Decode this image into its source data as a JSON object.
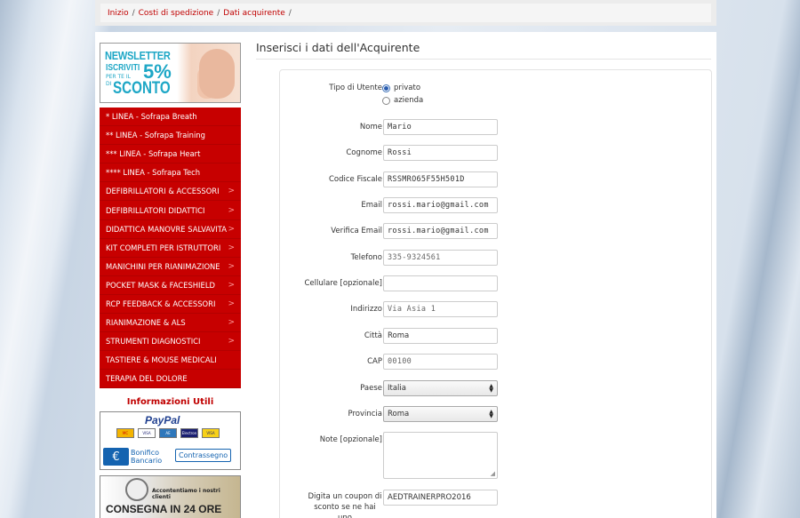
{
  "breadcrumb": {
    "items": [
      "Inizio",
      "Costi di spedizione",
      "Dati acquirente"
    ],
    "separator": "/"
  },
  "banner": {
    "line1": "NEWSLETTER",
    "line2": "ISCRIVITI",
    "line3": "PER TE IL",
    "percent": "5%",
    "line5": "DI",
    "line6": "SCONTO"
  },
  "sidebar": {
    "items": [
      {
        "label": "* LINEA - Sofrapa Breath",
        "submenu": false
      },
      {
        "label": "** LINEA - Sofrapa Training",
        "submenu": false
      },
      {
        "label": "*** LINEA - Sofrapa Heart",
        "submenu": false
      },
      {
        "label": "**** LINEA - Sofrapa Tech",
        "submenu": false
      },
      {
        "label": "DEFIBRILLATORI & ACCESSORI",
        "submenu": true
      },
      {
        "label": "DEFIBRILLATORI DIDATTICI",
        "submenu": true
      },
      {
        "label": "DIDATTICA MANOVRE SALVAVITA",
        "submenu": true
      },
      {
        "label": "KIT COMPLETI PER ISTRUTTORI",
        "submenu": true
      },
      {
        "label": "MANICHINI PER RIANIMAZIONE",
        "submenu": true
      },
      {
        "label": "POCKET MASK & FACESHIELD",
        "submenu": true
      },
      {
        "label": "RCP FEEDBACK & ACCESSORI",
        "submenu": true
      },
      {
        "label": "RIANIMAZIONE & ALS",
        "submenu": true
      },
      {
        "label": "STRUMENTI DIAGNOSTICI",
        "submenu": true
      },
      {
        "label": "TASTIERE & MOUSE MEDICALI",
        "submenu": false
      },
      {
        "label": "TERAPIA DEL DOLORE",
        "submenu": false
      }
    ],
    "chevron": ">",
    "info_title": "Informazioni Utili",
    "payment": {
      "paypal": "PayPal",
      "cards": [
        "MC",
        "VISA",
        "AE",
        "Electron",
        "VISA"
      ],
      "bonifico_line1": "Bonifico",
      "bonifico_line2": "Bancario",
      "euro": "€",
      "contrassegno": "Contrassegno"
    },
    "shipping": {
      "top": "Accontentiamo i nostri clienti",
      "main": "CONSEGNA IN 24 ORE"
    }
  },
  "form": {
    "title": "Inserisci i dati dell'Acquirente",
    "tipo_label": "Tipo di Utente",
    "tipo_options": [
      "privato",
      "azienda"
    ],
    "tipo_selected": "privato",
    "nome_label": "Nome",
    "nome_value": "Mario",
    "cognome_label": "Cognome",
    "cognome_value": "Rossi",
    "cf_label": "Codice Fiscale",
    "cf_value": "RSSMRO65F55H501D",
    "email_label": "Email",
    "email_value": "rossi.mario@gmail.com",
    "verifica_label": "Verifica Email",
    "verifica_value": "rossi.mario@gmail.com",
    "telefono_label": "Telefono",
    "telefono_value": "335-9324561",
    "cellulare_label": "Cellulare [opzionale]",
    "cellulare_value": "",
    "indirizzo_label": "Indirizzo",
    "indirizzo_value": "Via Asia 1",
    "citta_label": "Città",
    "citta_value": "Roma",
    "cap_label": "CAP",
    "cap_value": "00100",
    "paese_label": "Paese",
    "paese_value": "Italia",
    "provincia_label": "Provincia",
    "provincia_value": "Roma",
    "note_label": "Note [opzionale]",
    "coupon_label_1": "Digita un coupon di",
    "coupon_label_2": "sconto se ne hai uno",
    "coupon_value": "AEDTRAINERPRO2016"
  },
  "colors": {
    "accent_red": "#c70000",
    "link_red": "#c00000",
    "radio_blue": "#2a5db0"
  }
}
